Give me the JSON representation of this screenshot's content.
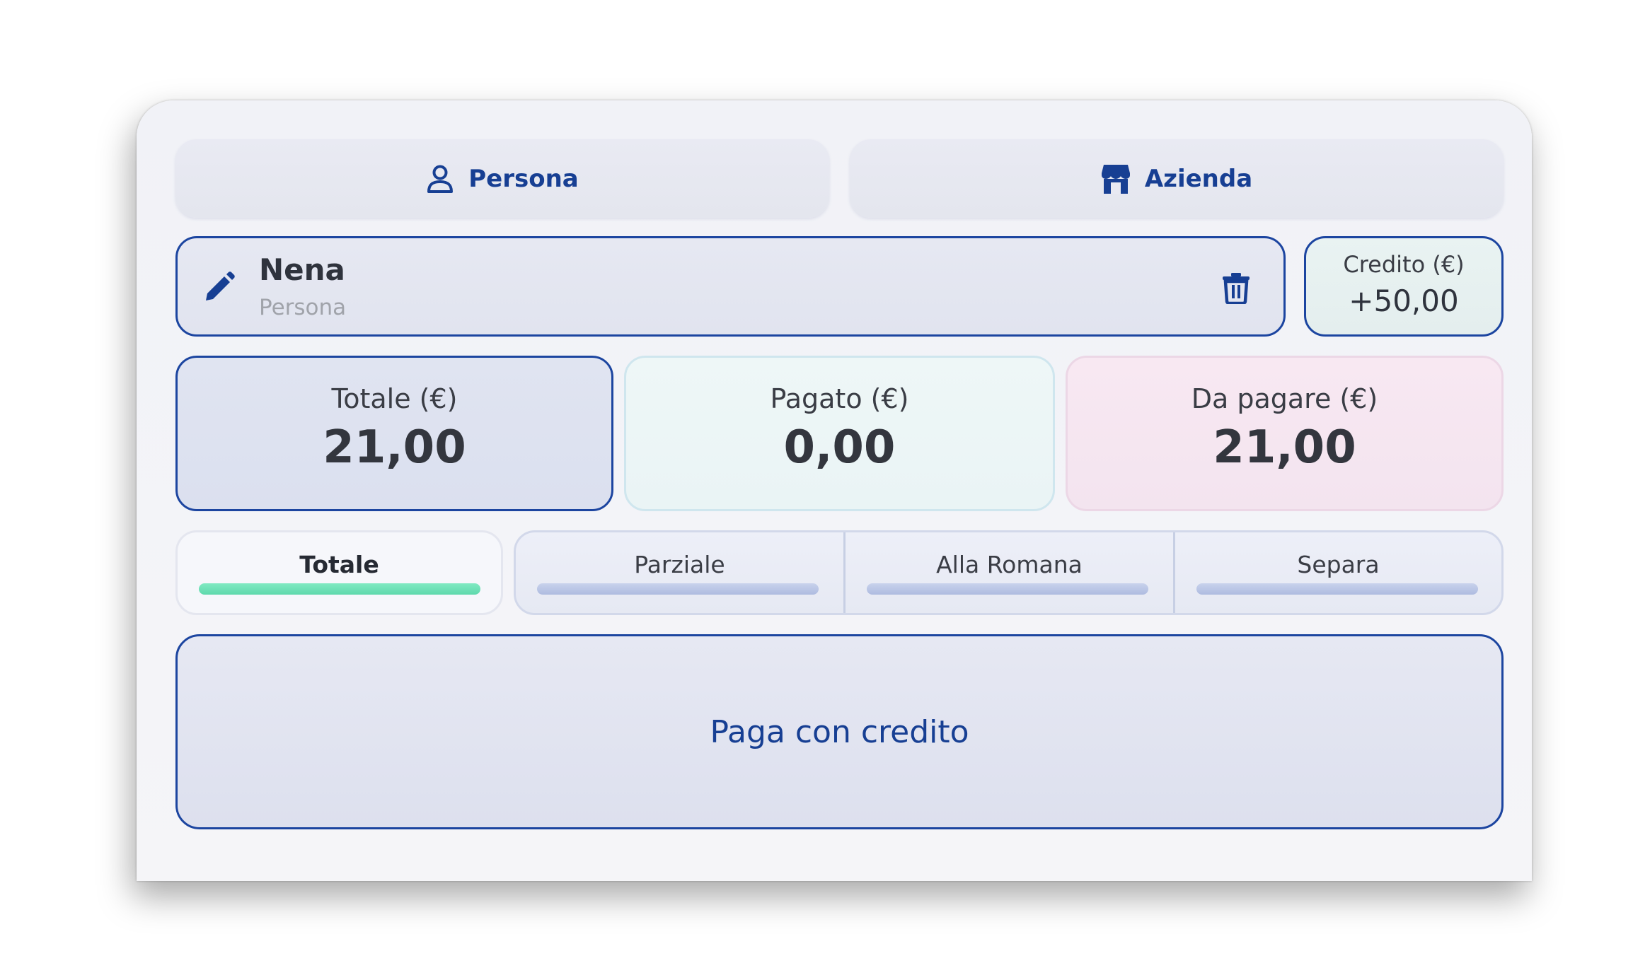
{
  "toggle": {
    "persona_label": "Persona",
    "azienda_label": "Azienda"
  },
  "customer": {
    "name": "Nena",
    "type": "Persona"
  },
  "credit": {
    "label": "Credito (€)",
    "value": "+50,00"
  },
  "summary": {
    "total_label": "Totale (€)",
    "total_value": "21,00",
    "paid_label": "Pagato (€)",
    "paid_value": "0,00",
    "due_label": "Da pagare (€)",
    "due_value": "21,00"
  },
  "split_tabs": [
    {
      "label": "Totale",
      "active": true
    },
    {
      "label": "Parziale",
      "active": false
    },
    {
      "label": "Alla Romana",
      "active": false
    },
    {
      "label": "Separa",
      "active": false
    }
  ],
  "pay_button": {
    "label": "Paga con credito"
  },
  "colors": {
    "accent": "#1c45a0",
    "active_tab": "#6ee0b6",
    "paid_card": "#eaf4f5",
    "due_card": "#f5e5f0"
  },
  "icons": {
    "persona": "person-icon",
    "azienda": "store-icon",
    "edit": "pencil-icon",
    "delete": "trash-icon"
  }
}
